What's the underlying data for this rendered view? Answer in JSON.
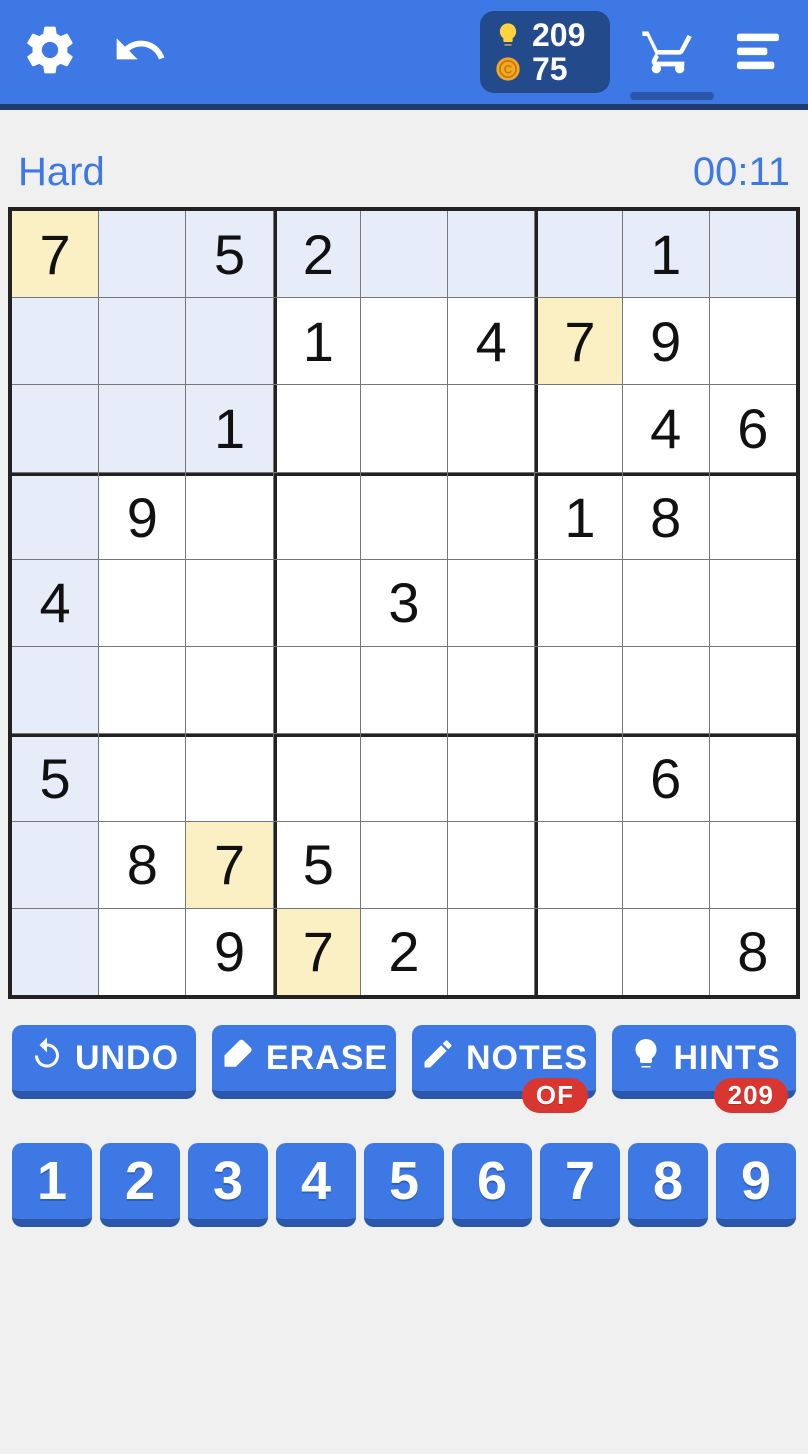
{
  "header": {
    "hints_count": "209",
    "coins_count": "75"
  },
  "status": {
    "difficulty": "Hard",
    "timer": "00:11"
  },
  "board": {
    "cells": [
      [
        "7",
        "",
        "5",
        "2",
        "",
        "",
        "",
        "1",
        ""
      ],
      [
        "",
        "",
        "",
        "1",
        "",
        "4",
        "7",
        "9",
        ""
      ],
      [
        "",
        "",
        "1",
        "",
        "",
        "",
        "",
        "4",
        "6"
      ],
      [
        "",
        "9",
        "",
        "",
        "",
        "",
        "1",
        "8",
        ""
      ],
      [
        "4",
        "",
        "",
        "",
        "3",
        "",
        "",
        "",
        ""
      ],
      [
        "",
        "",
        "",
        "",
        "",
        "",
        "",
        "",
        ""
      ],
      [
        "5",
        "",
        "",
        "",
        "",
        "",
        "",
        "6",
        ""
      ],
      [
        "",
        "8",
        "7",
        "5",
        "",
        "",
        "",
        "",
        ""
      ],
      [
        "",
        "",
        "9",
        "7",
        "2",
        "",
        "",
        "",
        "8"
      ]
    ],
    "highlight": [
      [
        0,
        0
      ],
      [
        1,
        6
      ],
      [
        7,
        2
      ],
      [
        8,
        3
      ]
    ]
  },
  "actions": {
    "undo": "UNDO",
    "erase": "ERASE",
    "notes": "NOTES",
    "notes_badge": "OF",
    "hints": "HINTS",
    "hints_badge": "209"
  },
  "numpad": [
    "1",
    "2",
    "3",
    "4",
    "5",
    "6",
    "7",
    "8",
    "9"
  ]
}
